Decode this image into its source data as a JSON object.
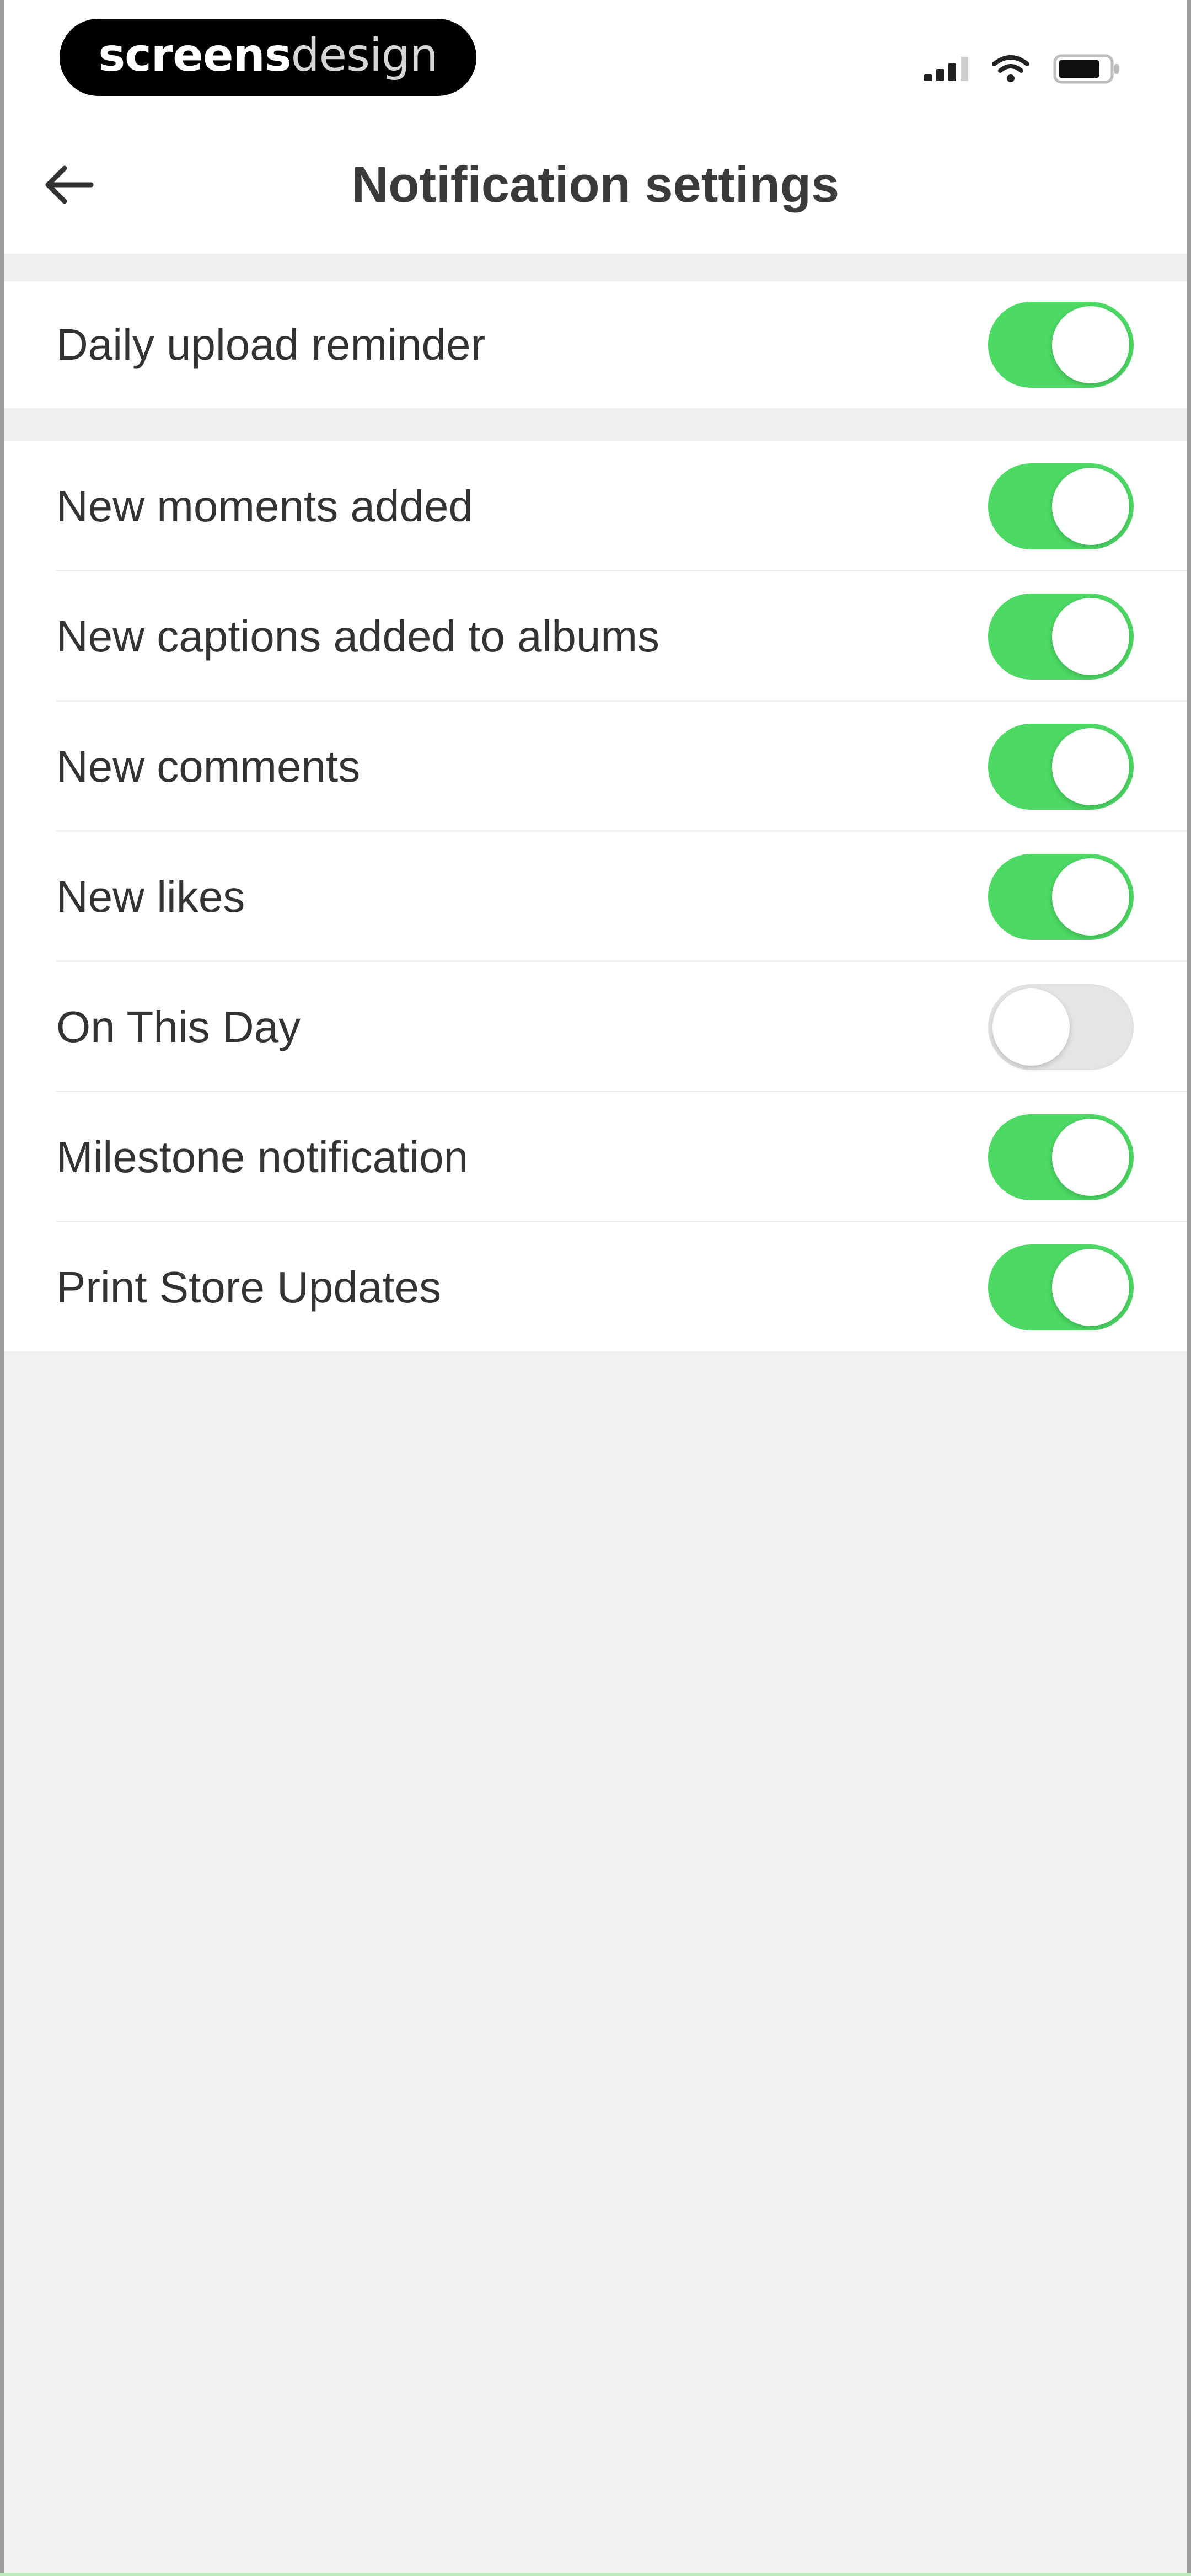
{
  "status_bar": {
    "brand_bold": "screens",
    "brand_light": "design",
    "icons": [
      "signal-icon",
      "wifi-icon",
      "battery-icon"
    ]
  },
  "header": {
    "back_icon": "arrow-left-icon",
    "title": "Notification settings"
  },
  "colors": {
    "toggle_on": "#4cd964",
    "toggle_off": "#e5e5e5",
    "background": "#f1f1f1",
    "row_background": "#ffffff"
  },
  "groups": [
    {
      "items": [
        {
          "label": "Daily upload reminder",
          "enabled": true
        }
      ]
    },
    {
      "items": [
        {
          "label": "New moments added",
          "enabled": true
        },
        {
          "label": "New captions added to albums",
          "enabled": true
        },
        {
          "label": "New comments",
          "enabled": true
        },
        {
          "label": "New likes",
          "enabled": true
        },
        {
          "label": "On This Day",
          "enabled": false
        },
        {
          "label": "Milestone notification",
          "enabled": true
        },
        {
          "label": "Print Store Updates",
          "enabled": true
        }
      ]
    }
  ]
}
